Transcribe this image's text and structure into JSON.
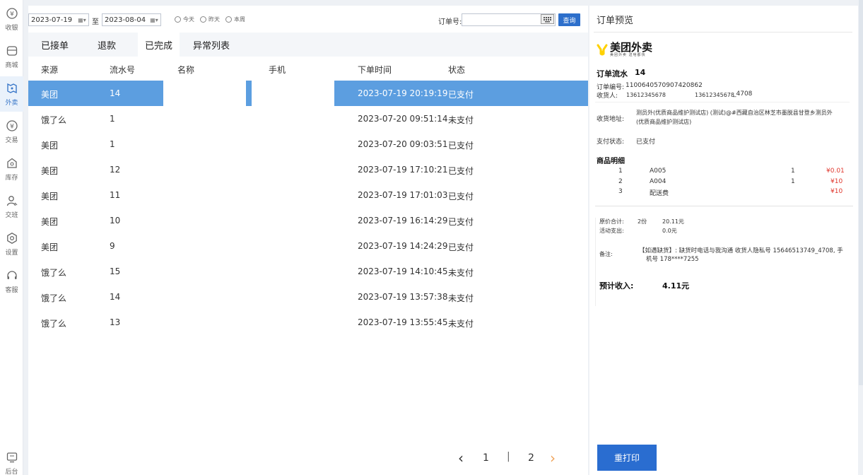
{
  "sidebar": {
    "items": [
      {
        "label": "收银",
        "icon": "cashier-icon"
      },
      {
        "label": "商城",
        "icon": "shop-icon"
      },
      {
        "label": "外卖",
        "icon": "delivery-icon"
      },
      {
        "label": "交易",
        "icon": "transaction-icon"
      },
      {
        "label": "库存",
        "icon": "inventory-icon"
      },
      {
        "label": "交班",
        "icon": "shift-icon"
      },
      {
        "label": "设置",
        "icon": "settings-icon"
      },
      {
        "label": "客服",
        "icon": "headset-icon"
      },
      {
        "label": "后台",
        "icon": "backend-icon"
      }
    ],
    "active_index": 2
  },
  "filters": {
    "date_from": "2023-07-19",
    "date_to": "2023-08-04",
    "date_sep": "至",
    "radio_today": "今天",
    "radio_yesterday": "昨天",
    "radio_week": "本周",
    "order_label": "订单号:",
    "order_value": "",
    "query_label": "查询"
  },
  "tabs": [
    {
      "label": "已接单"
    },
    {
      "label": "退款"
    },
    {
      "label": "已完成"
    },
    {
      "label": "异常列表"
    }
  ],
  "active_tab": 2,
  "table": {
    "columns": [
      "来源",
      "流水号",
      "名称",
      "手机",
      "下单时间",
      "状态"
    ],
    "rows": [
      {
        "source": "美团",
        "serial": "14",
        "name": "",
        "phone": "",
        "time": "2023-07-19 20:19:19",
        "status": "已支付",
        "selected": true
      },
      {
        "source": "饿了么",
        "serial": "1",
        "name": "",
        "phone": "",
        "time": "2023-07-20 09:51:14",
        "status": "未支付"
      },
      {
        "source": "美团",
        "serial": "1",
        "name": "",
        "phone": "",
        "time": "2023-07-20 09:03:51",
        "status": "已支付"
      },
      {
        "source": "美团",
        "serial": "12",
        "name": "",
        "phone": "",
        "time": "2023-07-19 17:10:21",
        "status": "已支付"
      },
      {
        "source": "美团",
        "serial": "11",
        "name": "",
        "phone": "",
        "time": "2023-07-19 17:01:03",
        "status": "已支付"
      },
      {
        "source": "美团",
        "serial": "10",
        "name": "",
        "phone": "",
        "time": "2023-07-19 16:14:29",
        "status": "已支付"
      },
      {
        "source": "美团",
        "serial": "9",
        "name": "",
        "phone": "",
        "time": "2023-07-19 14:24:29",
        "status": "已支付"
      },
      {
        "source": "饿了么",
        "serial": "15",
        "name": "",
        "phone": "",
        "time": "2023-07-19 14:10:45",
        "status": "未支付"
      },
      {
        "source": "饿了么",
        "serial": "14",
        "name": "",
        "phone": "",
        "time": "2023-07-19 13:57:38",
        "status": "未支付"
      },
      {
        "source": "饿了么",
        "serial": "13",
        "name": "",
        "phone": "",
        "time": "2023-07-19 13:55:45",
        "status": "未支付"
      }
    ]
  },
  "pagination": {
    "prev": "‹",
    "pages": [
      "1",
      "2"
    ],
    "divider": "|",
    "next": "›",
    "current": "1"
  },
  "preview": {
    "title": "订单预览",
    "brand_name": "美团外卖",
    "brand_slogan": "美团外卖 送啥都快",
    "serial_label": "订单流水",
    "serial_value": "14",
    "order_no_label": "订单编号:",
    "order_no_value": "1100640570907420862",
    "receiver_label": "收货人:",
    "receiver_phone1": "13612345678",
    "receiver_phone2": "13612345678",
    "receiver_ext": "_4708",
    "address_label": "收货地址:",
    "address_line1": "测员外(优质商品维护测试店) (测试)@#西藏自治区林芝市墨脱县甘登乡测员外",
    "address_line2": "(优质商品维护测试店)",
    "pay_label": "支付状态:",
    "pay_value": "已支付",
    "goods_title": "商品明细",
    "goods": [
      {
        "no": "1",
        "name": "A005",
        "qty": "1",
        "price": "¥0.01"
      },
      {
        "no": "2",
        "name": "A004",
        "qty": "1",
        "price": "¥10"
      },
      {
        "no": "3",
        "name": "配送费",
        "qty": "",
        "price": "¥10"
      }
    ],
    "orig_total_label": "原价合计:",
    "orig_total_count": "2份",
    "orig_total_value": "20.11元",
    "discount_label": "活动支出:",
    "discount_value": "0.0元",
    "note_label": "备注:",
    "note_line1": "【如遇缺货】: 缺货时电话与我沟通 收货人隐私号 15646513749_4708, 手",
    "note_line2": "机号 178****7255",
    "income_label": "预计收入:",
    "income_value": "4.11元",
    "reprint_label": "重打印"
  }
}
